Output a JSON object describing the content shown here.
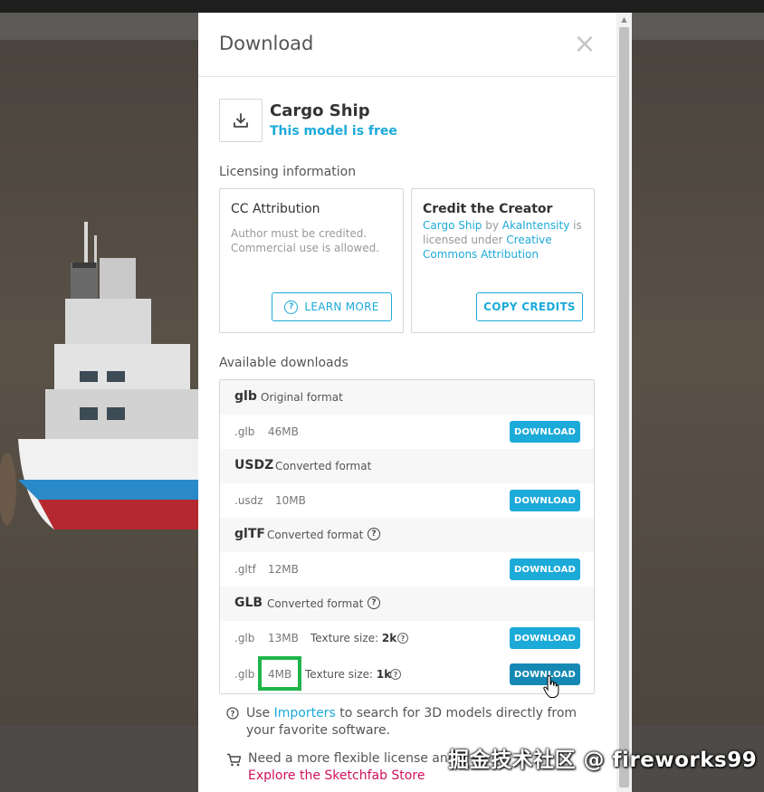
{
  "modal": {
    "title": "Download",
    "close_glyph": "×"
  },
  "model": {
    "name": "Cargo Ship",
    "price_status": "This model is free"
  },
  "licensing": {
    "section_label": "Licensing information",
    "cc_card": {
      "title": "CC Attribution",
      "description": "Author must be credited. Commercial use is allowed.",
      "button_label": "LEARN MORE"
    },
    "credit_card": {
      "title": "Credit the Creator",
      "model_link": "Cargo Ship",
      "by_text": " by ",
      "author_link": "AkaIntensity",
      "mid_text": " is licensed under ",
      "license_link": "Creative Commons Attribution",
      "button_label": "COPY CREDITS"
    }
  },
  "downloads": {
    "section_label": "Available downloads",
    "button_label": "DOWNLOAD",
    "formats": [
      {
        "name": "glb",
        "description": "Original format",
        "has_help": false,
        "files": [
          {
            "ext": ".glb",
            "size": "46MB",
            "texture_label": "",
            "texture_value": ""
          }
        ]
      },
      {
        "name": "USDZ",
        "description": "Converted format",
        "has_help": false,
        "files": [
          {
            "ext": ".usdz",
            "size": "10MB",
            "texture_label": "",
            "texture_value": ""
          }
        ]
      },
      {
        "name": "glTF",
        "description": "Converted format",
        "has_help": true,
        "files": [
          {
            "ext": ".gltf",
            "size": "12MB",
            "texture_label": "",
            "texture_value": ""
          }
        ]
      },
      {
        "name": "GLB",
        "description": "Converted format",
        "has_help": true,
        "files": [
          {
            "ext": ".glb",
            "size": "13MB",
            "texture_label": "Texture size:",
            "texture_value": "2k"
          },
          {
            "ext": ".glb",
            "size": "4MB",
            "texture_label": "Texture size:",
            "texture_value": "1k"
          }
        ]
      }
    ]
  },
  "footer": {
    "importers_prefix": "Use ",
    "importers_link": "Importers",
    "importers_suffix": " to search for 3D models directly from your favorite software.",
    "store_text": "Need a more flexible license and h",
    "store_link": "Explore the Sketchfab Store"
  },
  "watermark": "掘金技术社区 @ fireworks99",
  "icons": [
    "download-icon",
    "help-circle-icon",
    "cart-icon",
    "close-icon",
    "pointer-cursor-icon"
  ],
  "colors": {
    "accent": "#1caad9",
    "accent_hover": "#1589b3",
    "store_link": "#d0115c",
    "highlight": "#1fb44a"
  }
}
